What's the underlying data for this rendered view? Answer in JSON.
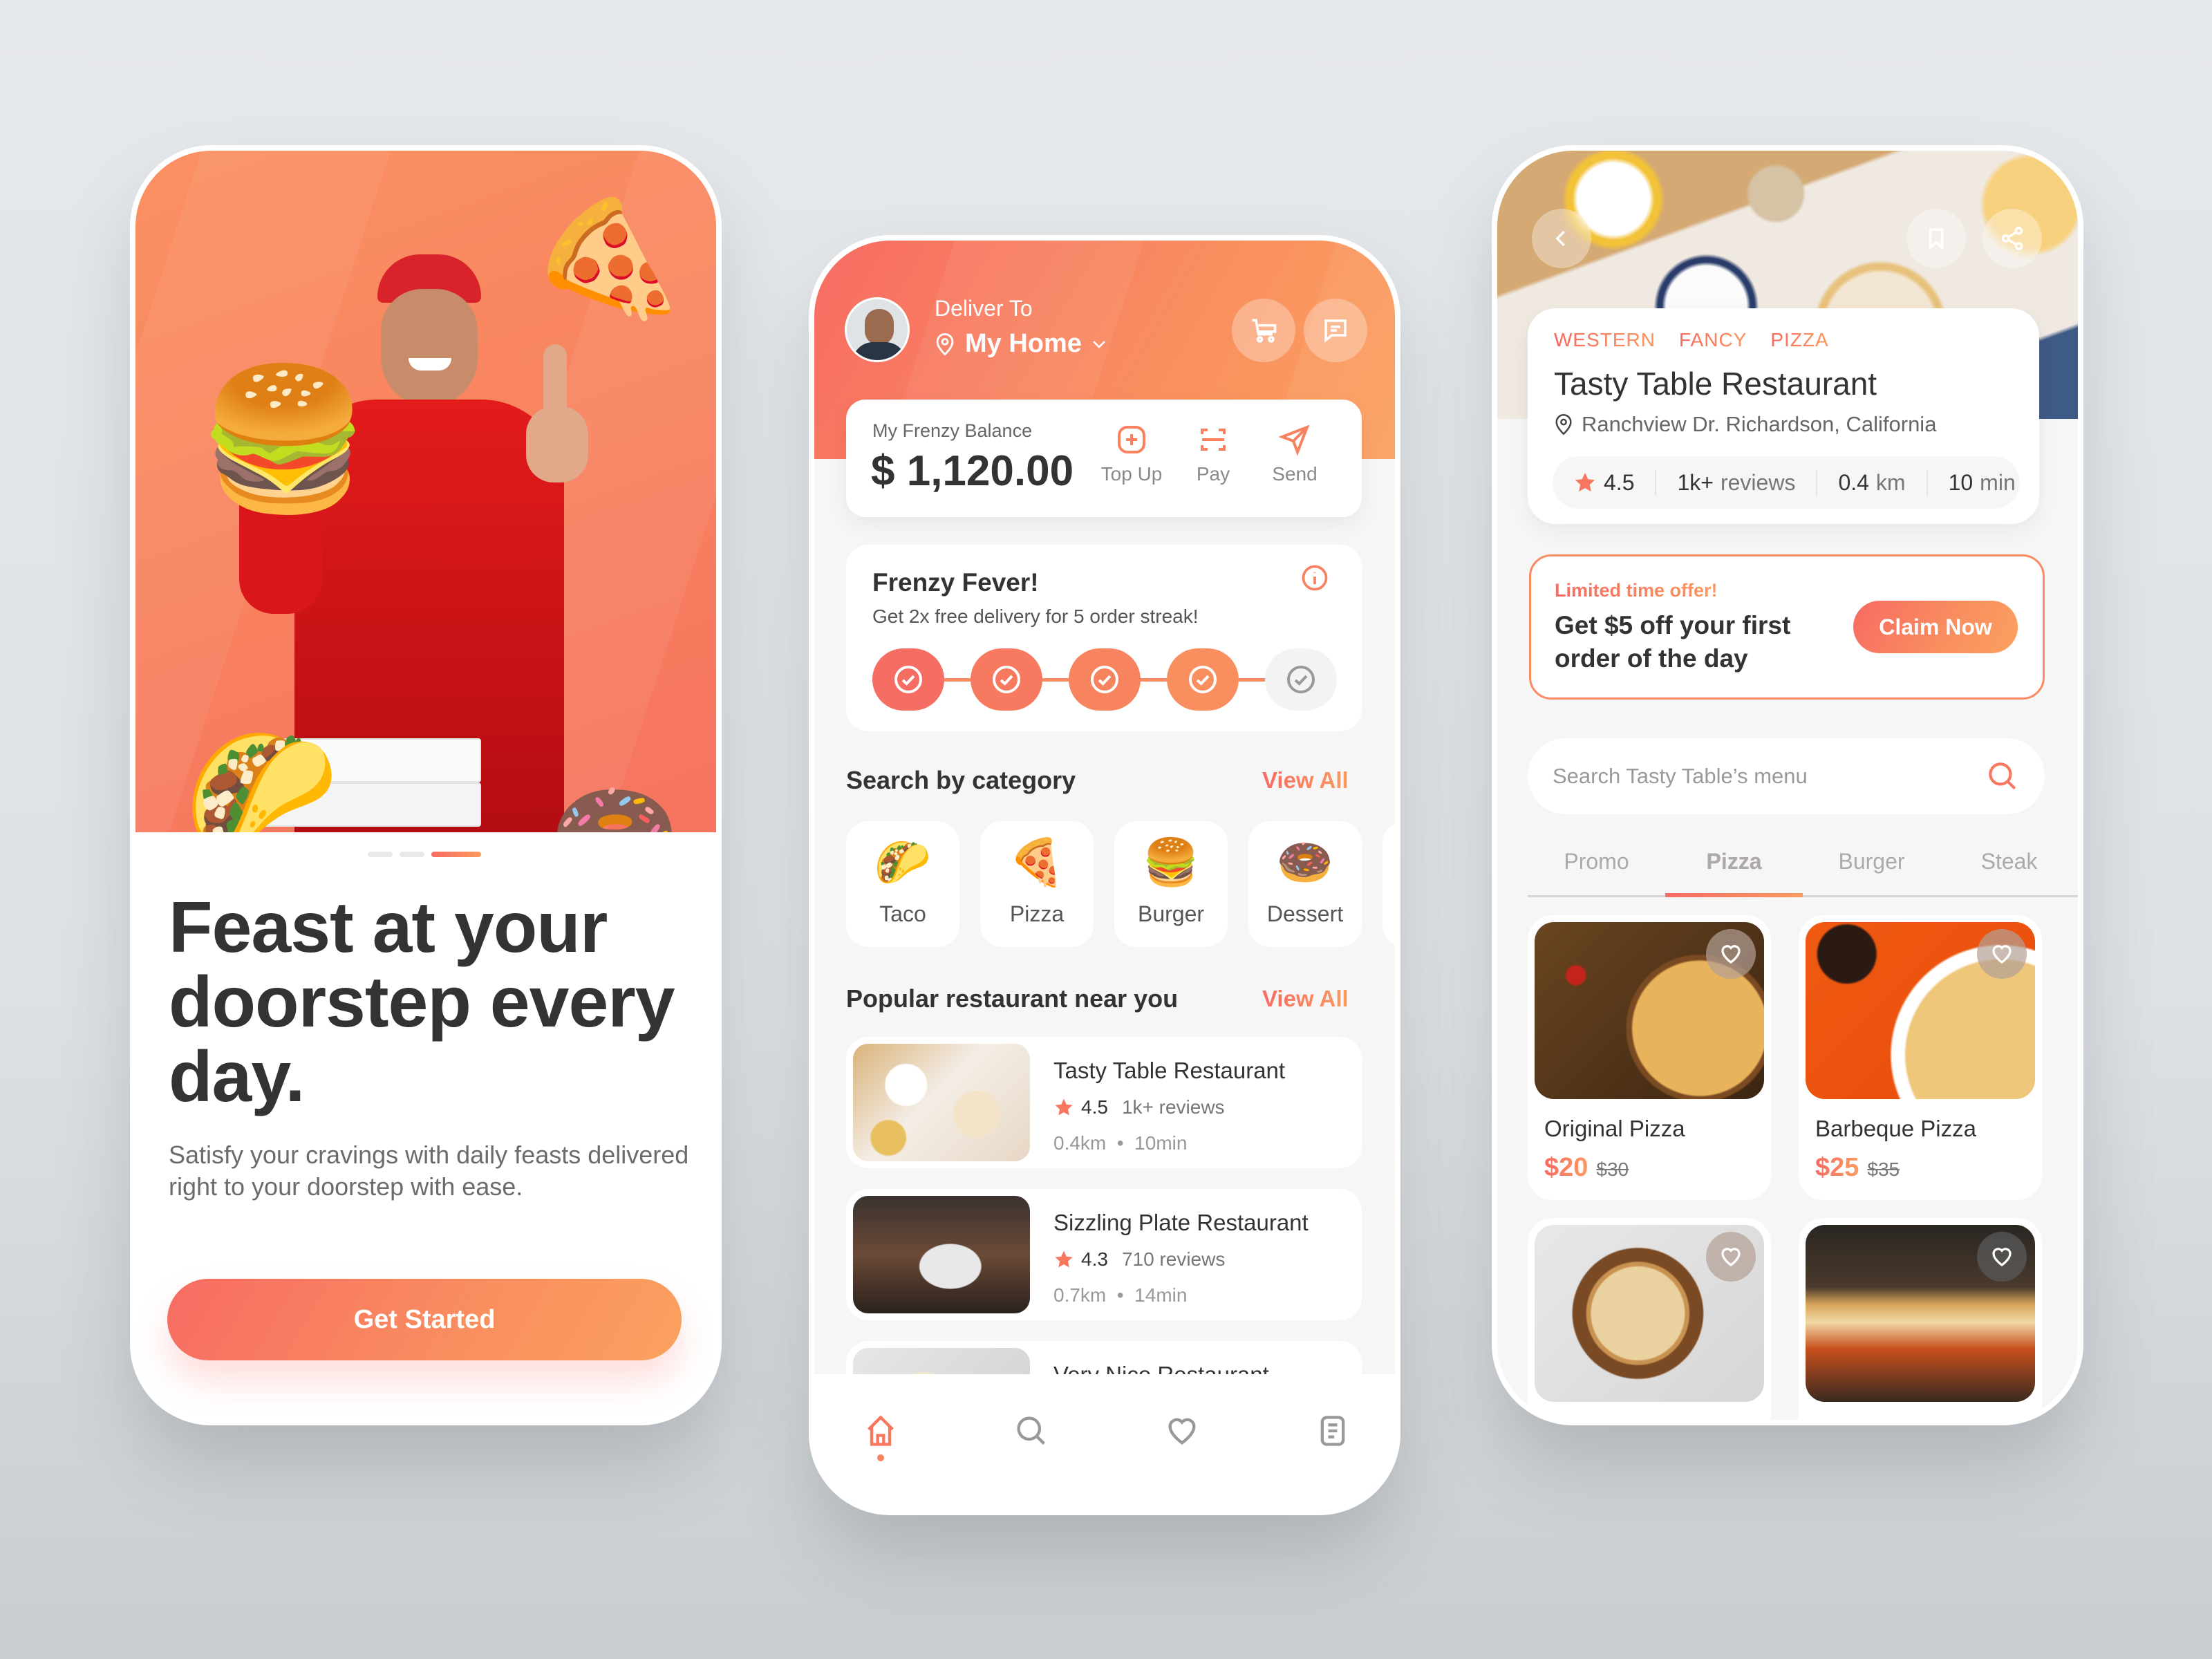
{
  "colors": {
    "accent_start": "#f76b63",
    "accent_end": "#fb9a5f",
    "background": "#e4e8eb",
    "text_dark": "#333333"
  },
  "onboarding": {
    "pagination": {
      "total": 3,
      "active": 3
    },
    "title": "Feast at your doorstep every day.",
    "subtitle": "Satisfy your cravings with daily feasts delivered right to your doorstep with ease.",
    "cta_label": "Get Started",
    "hero_icons": [
      "pizza-sticker",
      "burger-sticker",
      "taco-sticker",
      "donut-sticker"
    ]
  },
  "home": {
    "deliver_to_label": "Deliver To",
    "location": "My Home",
    "balance": {
      "label": "My Frenzy Balance",
      "amount": "$ 1,120.00"
    },
    "actions": [
      {
        "label": "Top Up",
        "icon": "plus-square-icon"
      },
      {
        "label": "Pay",
        "icon": "scan-icon"
      },
      {
        "label": "Send",
        "icon": "send-icon"
      }
    ],
    "fever": {
      "title": "Frenzy Fever!",
      "subtitle": "Get 2x free delivery for 5 order streak!",
      "streak_completed": 4,
      "streak_total": 5
    },
    "category_section": {
      "title": "Search by category",
      "view_all": "View All"
    },
    "categories": [
      {
        "label": "Taco",
        "emoji": "🌮"
      },
      {
        "label": "Pizza",
        "emoji": "🍕"
      },
      {
        "label": "Burger",
        "emoji": "🍔"
      },
      {
        "label": "Dessert",
        "emoji": "🍩"
      }
    ],
    "popular_section": {
      "title": "Popular restaurant near you",
      "view_all": "View All"
    },
    "restaurants": [
      {
        "name": "Tasty Table Restaurant",
        "rating": "4.5",
        "reviews": "1k+ reviews",
        "distance": "0.4km",
        "time": "10min"
      },
      {
        "name": "Sizzling Plate Restaurant",
        "rating": "4.3",
        "reviews": "710 reviews",
        "distance": "0.7km",
        "time": "14min"
      },
      {
        "name": "Very Nice Restaurant",
        "rating": "",
        "reviews": "",
        "distance": "",
        "time": ""
      }
    ],
    "nav": [
      {
        "name": "home",
        "active": true
      },
      {
        "name": "search",
        "active": false
      },
      {
        "name": "favorites",
        "active": false
      },
      {
        "name": "orders",
        "active": false
      }
    ]
  },
  "restaurant": {
    "tags": [
      "WESTERN",
      "FANCY",
      "PIZZA"
    ],
    "name": "Tasty Table Restaurant",
    "address": "Ranchview Dr. Richardson, California",
    "rating": "4.5",
    "reviews_count": "1k+",
    "reviews_label": "reviews",
    "distance_value": "0.4",
    "distance_unit": "km",
    "time_value": "10",
    "time_unit": "min",
    "offer": {
      "label": "Limited time offer!",
      "text": "Get $5 off your first order of the day",
      "button": "Claim Now"
    },
    "search_placeholder": "Search Tasty Table’s menu",
    "tabs": [
      {
        "label": "Promo",
        "active": false
      },
      {
        "label": "Pizza",
        "active": true
      },
      {
        "label": "Burger",
        "active": false
      },
      {
        "label": "Steak",
        "active": false
      }
    ],
    "dishes": [
      {
        "name": "Original Pizza",
        "price": "$20",
        "old_price": "$30"
      },
      {
        "name": "Barbeque Pizza",
        "price": "$25",
        "old_price": "$35"
      },
      {
        "name": "",
        "price": "",
        "old_price": ""
      },
      {
        "name": "",
        "price": "",
        "old_price": ""
      }
    ]
  }
}
